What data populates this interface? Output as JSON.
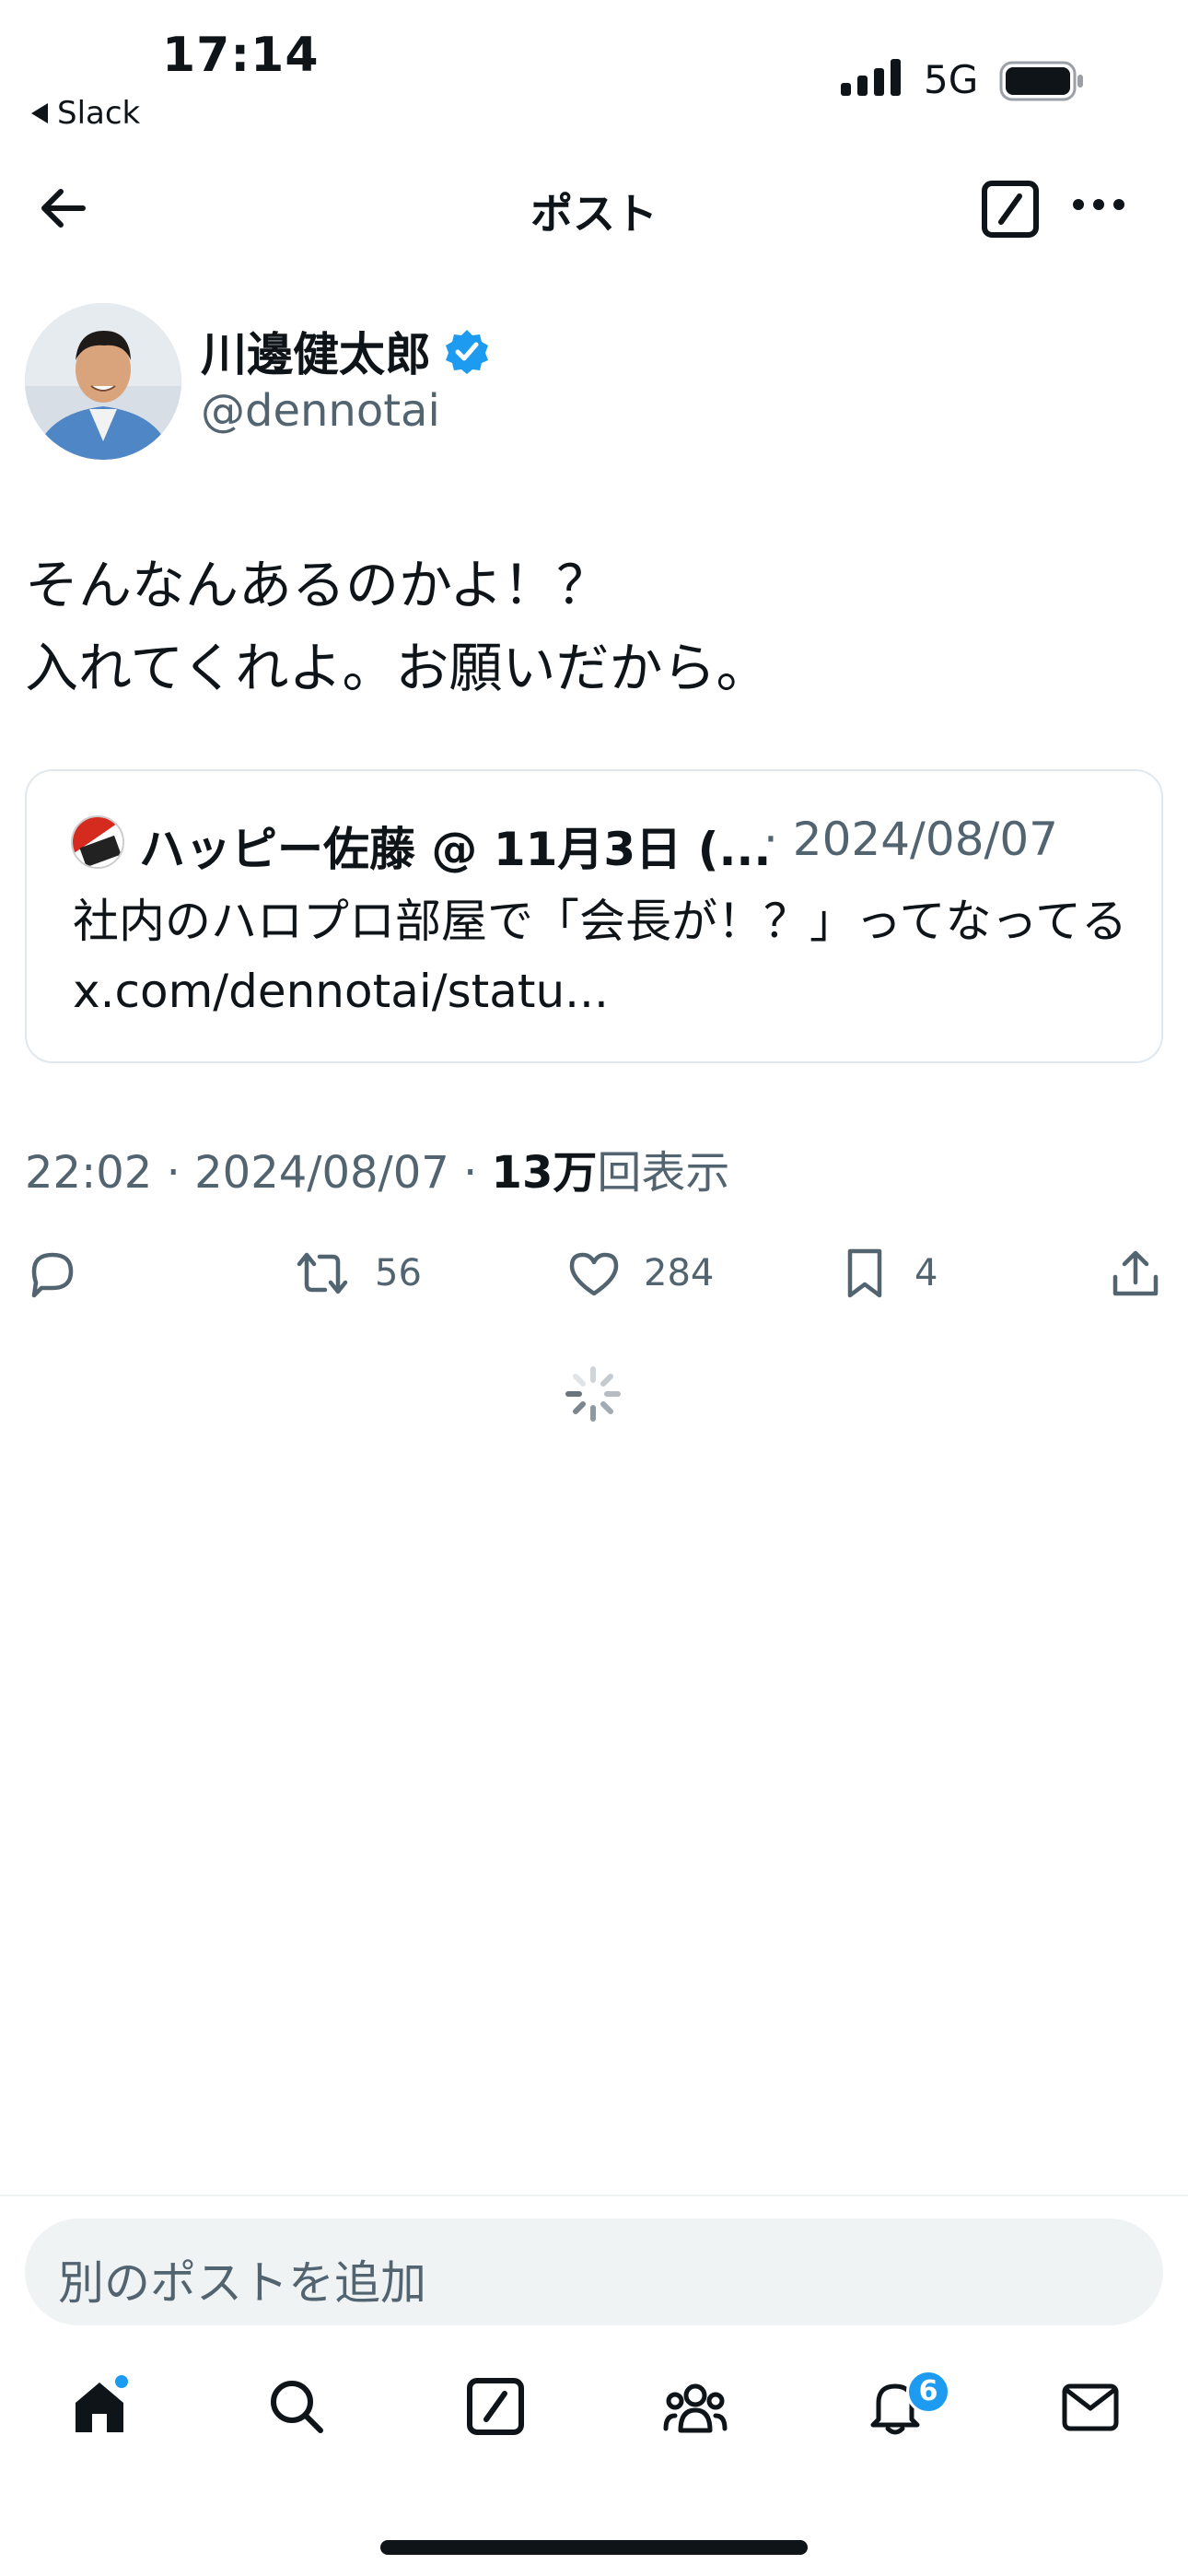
{
  "status_bar": {
    "time": "17:14",
    "back_app": "Slack",
    "network": "5G"
  },
  "nav": {
    "title": "ポスト"
  },
  "post": {
    "author_name": "川邊健太郎",
    "author_handle": "@dennotai",
    "verified": true,
    "text_lines": [
      "そんなんあるのかよ！？",
      "入れてくれよ。お願いだから。"
    ],
    "time": "22:02",
    "date": "2024/08/07",
    "views_count": "13万",
    "views_label": "回表示"
  },
  "quote": {
    "author": "ハッピー佐藤 @ 11月3日 (...",
    "date": "2024/08/07",
    "text": "社内のハロプロ部屋で「会長が！？」ってなってる x.com/dennotai/statu..."
  },
  "actions": {
    "retweets": "56",
    "likes": "284",
    "bookmarks": "4"
  },
  "composer": {
    "placeholder": "別のポストを追加"
  },
  "tab_bar": {
    "notification_badge": "6"
  },
  "colors": {
    "accent": "#1d9bf0",
    "text": "#0f1419",
    "secondary": "#536471",
    "border": "#e1e8ed"
  },
  "icons": [
    "back-arrow-icon",
    "compose-icon",
    "more-icon",
    "verified-icon",
    "reply-icon",
    "retweet-icon",
    "like-icon",
    "bookmark-icon",
    "share-icon",
    "loading-spinner-icon",
    "home-icon",
    "search-icon",
    "grok-icon",
    "communities-icon",
    "notifications-icon",
    "messages-icon"
  ]
}
